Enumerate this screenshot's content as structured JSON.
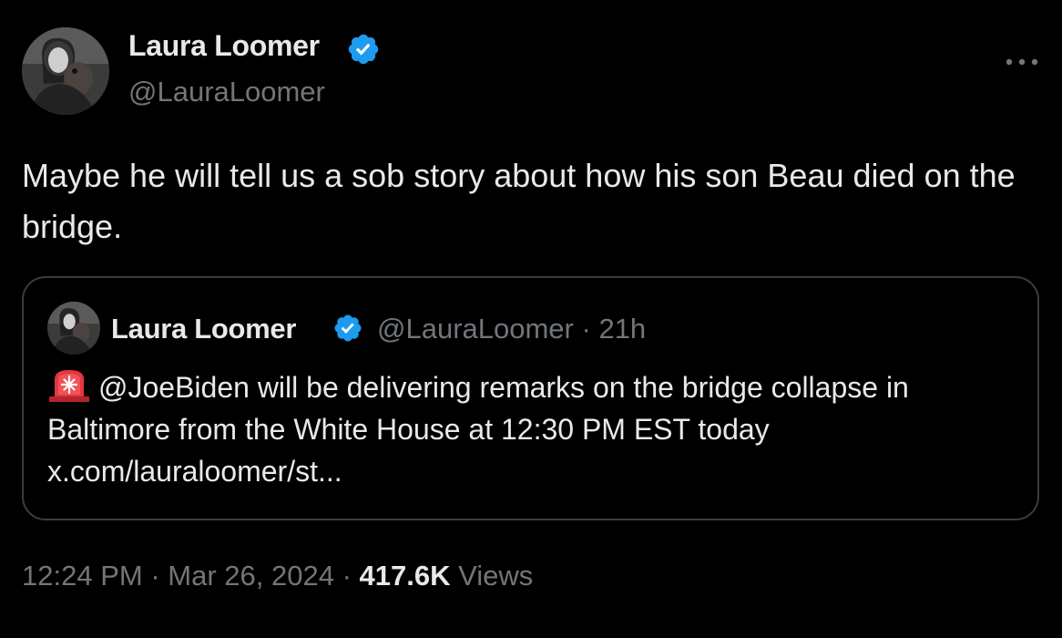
{
  "tweet": {
    "author": {
      "name": "Laura Loomer",
      "handle": "@LauraLoomer",
      "verified": true,
      "avatar_icon": "profile-photo"
    },
    "text": "Maybe he will tell us a sob story about how his son Beau died on the bridge.",
    "more_icon": "more-horizontal-icon",
    "quoted": {
      "author": {
        "name": "Laura Loomer",
        "handle": "@LauraLoomer",
        "verified": true
      },
      "separator": "·",
      "time_ago": "21h",
      "icon": "rotating-light-siren-icon",
      "text": "@JoeBiden will be delivering remarks on the bridge collapse in Baltimore from the White House at 12:30 PM EST today",
      "link": "x.com/lauraloomer/st..."
    },
    "footer": {
      "time": "12:24 PM",
      "separator": "·",
      "date": "Mar 26, 2024",
      "views_count": "417.6K",
      "views_label": "Views"
    }
  },
  "colors": {
    "background": "#000000",
    "primary_text": "#e7e9ea",
    "secondary_text": "#71767b",
    "verified_blue": "#1d9bf0",
    "card_border": "#3a3d40"
  }
}
